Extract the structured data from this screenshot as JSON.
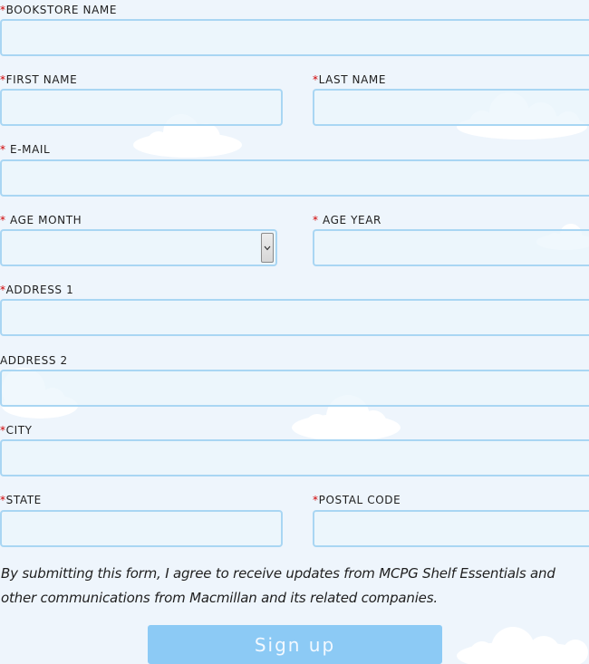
{
  "form": {
    "bookstore_name": {
      "required_mark": "*",
      "label": "BOOKSTORE NAME",
      "value": ""
    },
    "first_name": {
      "required_mark": "*",
      "label": "FIRST NAME",
      "value": ""
    },
    "last_name": {
      "required_mark": "*",
      "label": "LAST NAME",
      "value": ""
    },
    "email": {
      "required_mark": "*",
      "label": " E-MAIL",
      "value": ""
    },
    "age_month": {
      "required_mark": "*",
      "label": " AGE MONTH",
      "selected": ""
    },
    "age_year": {
      "required_mark": "*",
      "label": " AGE YEAR",
      "value": ""
    },
    "address1": {
      "required_mark": "*",
      "label": "ADDRESS 1",
      "value": ""
    },
    "address2": {
      "label": "ADDRESS 2",
      "value": ""
    },
    "city": {
      "required_mark": "*",
      "label": "CITY",
      "value": ""
    },
    "state": {
      "required_mark": "*",
      "label": "STATE",
      "value": ""
    },
    "postal_code": {
      "required_mark": "*",
      "label": "POSTAL CODE",
      "value": ""
    }
  },
  "consent_text": "By submitting this form, I agree to receive updates from MCPG Shelf Essentials and other communications from Macmillan and its related companies.",
  "submit_label": "Sign up",
  "icons": {
    "select_arrow": "chevron-down-icon",
    "background": "cloud-icon"
  },
  "colors": {
    "background": "#eef5fc",
    "field_border": "#a9d6f3",
    "required": "#d00000",
    "button": "#8ccaf5",
    "button_text": "#f3f9ff"
  }
}
